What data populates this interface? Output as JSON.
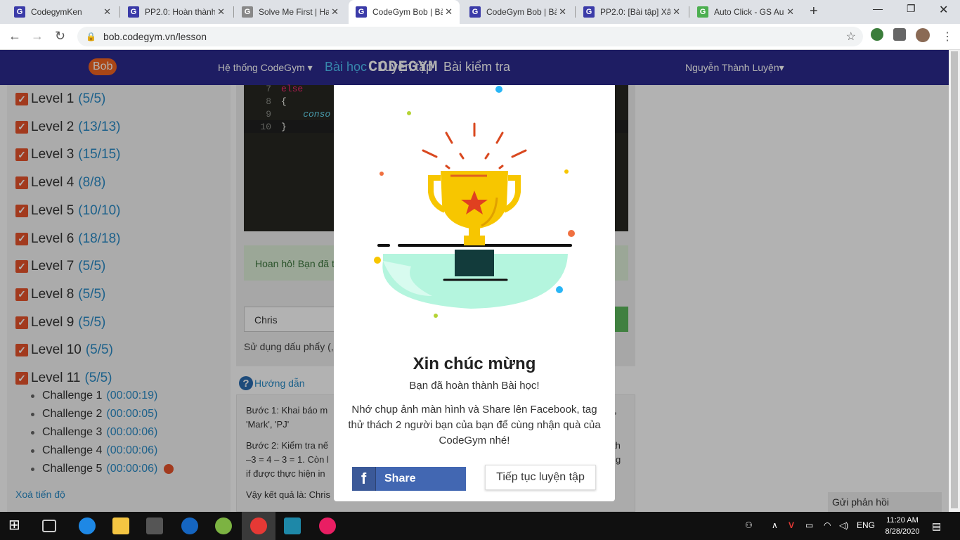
{
  "browser": {
    "tabs": [
      {
        "title": "CodegymKen",
        "fav_color": "#3b3ba8"
      },
      {
        "title": "PP2.0: Hoàn thành",
        "fav_color": "#3b3ba8"
      },
      {
        "title": "Solve Me First | Ha",
        "fav_color": "#888888"
      },
      {
        "title": "CodeGym Bob | Bà",
        "fav_color": "#3b3ba8"
      },
      {
        "title": "CodeGym Bob | Bà",
        "fav_color": "#3b3ba8"
      },
      {
        "title": "PP2.0: [Bài tập] Xâ",
        "fav_color": "#3b3ba8"
      },
      {
        "title": "Auto Click - GS Au",
        "fav_color": "#4caf50"
      }
    ],
    "fav_letter": "G",
    "url": "bob.codegym.vn/lesson"
  },
  "nav": {
    "logo_text": "CODEGYM",
    "logo_badge": "Bob",
    "system": "Hệ thống CodeGym ▾",
    "lesson": "Bài học",
    "practice": "Luyện tập",
    "test": "Bài kiểm tra",
    "user": "Nguyễn Thành Luyện▾"
  },
  "sidebar": {
    "levels": [
      {
        "name": "Level 1",
        "count": "(5/5)"
      },
      {
        "name": "Level 2",
        "count": "(13/13)"
      },
      {
        "name": "Level 3",
        "count": "(15/15)"
      },
      {
        "name": "Level 4",
        "count": "(8/8)"
      },
      {
        "name": "Level 5",
        "count": "(10/10)"
      },
      {
        "name": "Level 6",
        "count": "(18/18)"
      },
      {
        "name": "Level 7",
        "count": "(5/5)"
      },
      {
        "name": "Level 8",
        "count": "(5/5)"
      },
      {
        "name": "Level 9",
        "count": "(5/5)"
      },
      {
        "name": "Level 10",
        "count": "(5/5)"
      },
      {
        "name": "Level 11",
        "count": "(5/5)"
      }
    ],
    "challenges": [
      {
        "name": "Challenge 1",
        "time": "(00:00:19)"
      },
      {
        "name": "Challenge 2",
        "time": "(00:00:05)"
      },
      {
        "name": "Challenge 3",
        "time": "(00:00:06)"
      },
      {
        "name": "Challenge 4",
        "time": "(00:00:06)"
      },
      {
        "name": "Challenge 5",
        "time": "(00:00:06)"
      }
    ],
    "reset": "Xoá tiến độ"
  },
  "editor": {
    "lines": [
      {
        "num": "7",
        "code": "else"
      },
      {
        "num": "8",
        "code": "{"
      },
      {
        "num": "9",
        "code": "    conso"
      },
      {
        "num": "10",
        "code": "}"
      }
    ]
  },
  "main": {
    "success": "Hoan hô! Bạn đã t",
    "input_value": "Chris",
    "hint": "Sử dụng dấu phẩy (,",
    "guide": "Hướng dẫn",
    "step1a": "Bước 1: Khai báo m",
    "step1b": "'Mark', 'PJ'",
    "step2a": "Bước 2: Kiểm tra nế",
    "step2b": "–3 = 4 – 3 = 1. Còn l",
    "step2c": "if được thực hiện in",
    "result": "Vậy kết quả là: Chris",
    "right1": ",",
    "right2": "th",
    "right3": "g",
    "feedback": "Gửi phản hồi"
  },
  "modal": {
    "title": "Xin chúc mừng",
    "subtitle": "Bạn đã hoàn thành Bài học!",
    "body": "Nhớ chụp ảnh màn hình và Share lên Facebook, tag thử thách 2 người bạn của bạn để cùng nhận quà của CodeGym nhé!",
    "share": "Share",
    "fb_letter": "f",
    "continue": "Tiếp tục luyện tập"
  },
  "taskbar": {
    "lang": "ENG",
    "time": "11:20 AM",
    "date": "8/28/2020"
  }
}
